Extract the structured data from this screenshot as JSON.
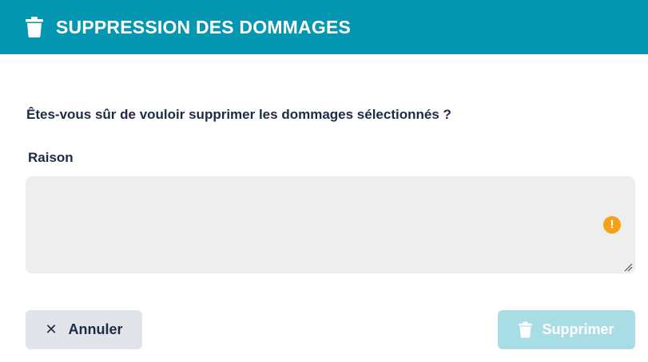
{
  "dialog": {
    "title": "SUPPRESSION DES DOMMAGES",
    "header_icon": "trash-icon",
    "header_color": "#0597b2"
  },
  "body": {
    "question": "Êtes-vous sûr de vouloir supprimer les dommages sélectionnés ?",
    "reason_label": "Raison",
    "reason_value": "",
    "reason_placeholder": "",
    "warning_icon": "warning-icon",
    "warning_color": "#f5a11a"
  },
  "actions": {
    "cancel_label": "Annuler",
    "cancel_icon": "close-icon",
    "delete_label": "Supprimer",
    "delete_icon": "trash-icon",
    "delete_color": "#a9dde6"
  }
}
